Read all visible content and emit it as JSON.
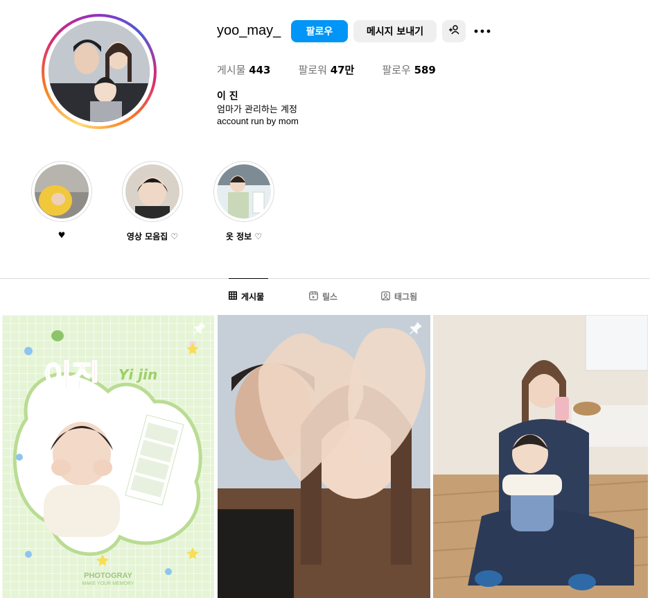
{
  "profile": {
    "username": "yoo_may_",
    "follow_label": "팔로우",
    "message_label": "메시지 보내기",
    "stats": {
      "posts_label": "게시물",
      "posts_value": "443",
      "followers_label": "팔로워",
      "followers_value": "47만",
      "following_label": "팔로우",
      "following_value": "589"
    },
    "full_name": "이 진",
    "bio_line1": "엄마가 관리하는 계정",
    "bio_line2": "account run by mom"
  },
  "highlights": [
    {
      "label": "♥"
    },
    {
      "label": "영상 모음집 ♡"
    },
    {
      "label": "옷 정보 ♡"
    }
  ],
  "tabs": [
    {
      "label": "게시물",
      "icon": "grid-icon",
      "active": true
    },
    {
      "label": "릴스",
      "icon": "reels-icon",
      "active": false
    },
    {
      "label": "태그됨",
      "icon": "tagged-icon",
      "active": false
    }
  ],
  "posts": [
    {
      "title_text": "이진",
      "subtitle_text": "Yi jin",
      "brand": "PHOTOGRAY",
      "brand_sub": "MAKE YOUR MEMORY",
      "pinned": true
    },
    {
      "pinned": true
    },
    {
      "pinned": false
    }
  ],
  "colors": {
    "accent": "#0095f6",
    "secondary_button": "#efefef",
    "divider": "#dbdbdb",
    "muted_text": "#737373"
  }
}
